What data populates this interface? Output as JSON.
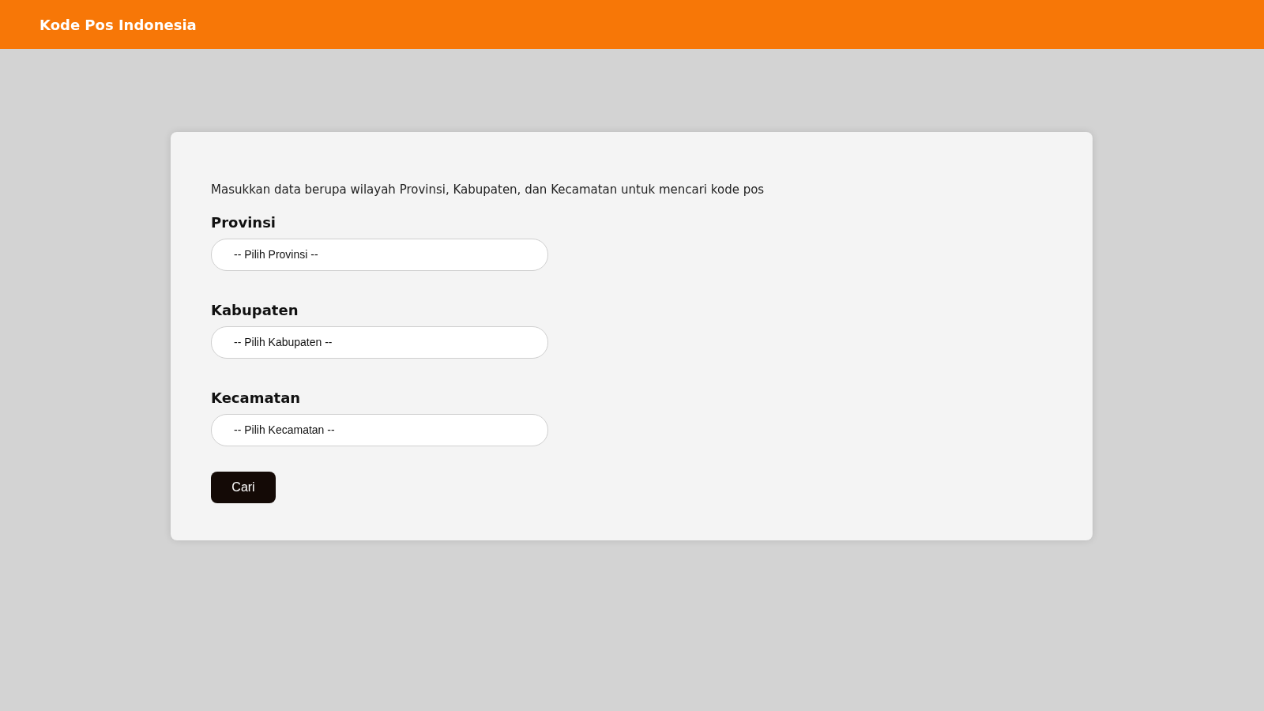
{
  "header": {
    "title": "Kode Pos Indonesia"
  },
  "form": {
    "intro": "Masukkan data berupa wilayah Provinsi, Kabupaten, dan Kecamatan untuk mencari kode pos",
    "fields": [
      {
        "label": "Provinsi",
        "value": "-- Pilih Provinsi --"
      },
      {
        "label": "Kabupaten",
        "value": "-- Pilih Kabupaten --"
      },
      {
        "label": "Kecamatan",
        "value": "-- Pilih Kecamatan --"
      }
    ],
    "button": "Cari"
  }
}
